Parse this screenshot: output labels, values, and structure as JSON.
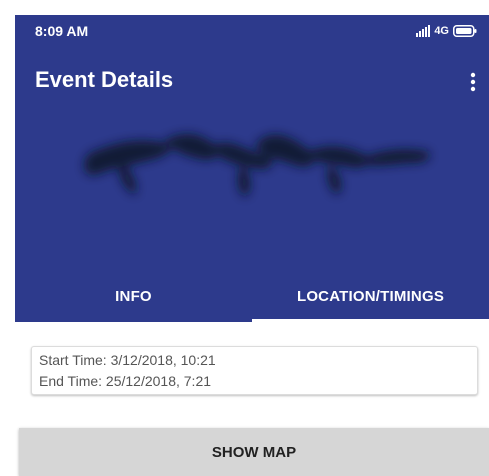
{
  "status_bar": {
    "time": "8:09 AM",
    "network_label": "4G",
    "icons": [
      "signal-icon",
      "battery-icon"
    ]
  },
  "toolbar": {
    "title": "Event Details",
    "menu_icon": "more-vert-icon"
  },
  "tabs": [
    {
      "label": "INFO",
      "selected": false
    },
    {
      "label": "LOCATION/TIMINGS",
      "selected": true
    }
  ],
  "timings": {
    "start": "Start Time: 3/12/2018, 10:21",
    "end": "End Time: 25/12/2018, 7:21"
  },
  "show_map_button": {
    "label": "SHOW MAP"
  },
  "colors": {
    "app_bar": "#2d3a8c",
    "tab_indicator": "#ffffff",
    "button_bg": "#d6d6d6"
  }
}
